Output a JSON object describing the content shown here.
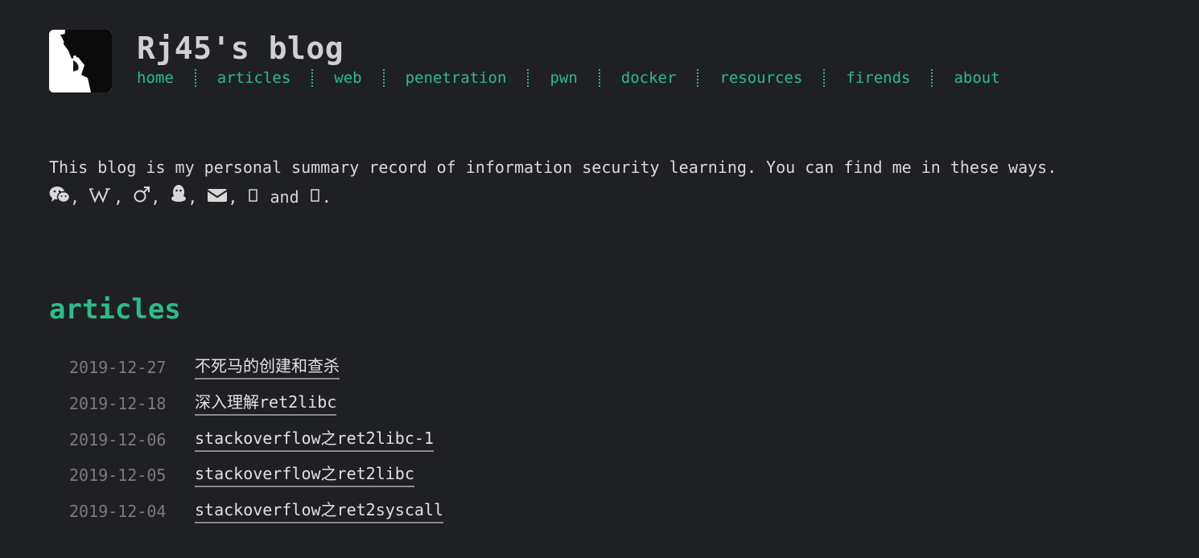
{
  "site": {
    "title": "Rj45's blog"
  },
  "nav": [
    {
      "label": "home"
    },
    {
      "label": "articles"
    },
    {
      "label": "web"
    },
    {
      "label": "penetration"
    },
    {
      "label": "pwn"
    },
    {
      "label": "docker"
    },
    {
      "label": "resources"
    },
    {
      "label": "firends"
    },
    {
      "label": "about"
    }
  ],
  "intro": {
    "text": "This blog is my personal summary record of information security learning. You can find me in these ways.",
    "sep": ",",
    "and": "and",
    "period": ".",
    "icons": [
      "wechat-icon",
      "wikipedia-icon",
      "gender-icon",
      "qq-icon",
      "mail-icon",
      "missing-glyph-icon",
      "missing-glyph-icon"
    ]
  },
  "articles": {
    "heading": "articles",
    "items": [
      {
        "date": "2019-12-27",
        "title": "不死马的创建和查杀"
      },
      {
        "date": "2019-12-18",
        "title": "深入理解ret2libc"
      },
      {
        "date": "2019-12-06",
        "title": "stackoverflow之ret2libc-1"
      },
      {
        "date": "2019-12-05",
        "title": "stackoverflow之ret2libc"
      },
      {
        "date": "2019-12-04",
        "title": "stackoverflow之ret2syscall"
      }
    ]
  },
  "colors": {
    "background": "#1f2023",
    "accent": "#2bbc8a",
    "text": "#d9d9d9",
    "date": "#7a7a7a"
  }
}
